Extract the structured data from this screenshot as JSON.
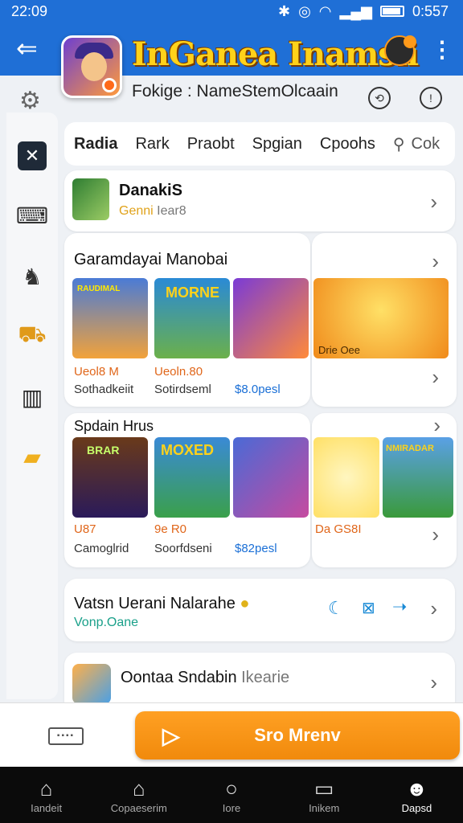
{
  "status_bar": {
    "time": "22:09",
    "clock": "0:557"
  },
  "header": {
    "title": "InGanea Inamsii",
    "subtitle": "Fokige : NameStemOlcaain",
    "back_icon": "arrow-left-icon",
    "menu_icon": "kebab-icon"
  },
  "tabs": [
    {
      "label": "Radia",
      "active": true
    },
    {
      "label": "Rark"
    },
    {
      "label": "Praobt"
    },
    {
      "label": "Spgian"
    },
    {
      "label": "Cpoohs"
    }
  ],
  "tab_search_label": "Cok",
  "rail_items": [
    "settings-icon",
    "close-box-icon",
    "controller-icon",
    "dino-icon",
    "cart-icon",
    "panel-icon",
    "folder-icon"
  ],
  "danakis": {
    "title": "DanakiS",
    "sub": "Genni",
    "sub2": "Iear8"
  },
  "section1": {
    "title": "Garamdayai Manobai",
    "tiles": [
      {
        "art": "RAUDIMAL",
        "value": "Ueol8 M",
        "name": "Sothadkeiit"
      },
      {
        "art": "MORNE",
        "value": "Ueoln.80",
        "name": "Sotirdseml"
      },
      {
        "art": "",
        "value": "",
        "name": "$8.0pesl"
      },
      {
        "art": "",
        "value": "",
        "name": "Drie Oee"
      }
    ]
  },
  "section2": {
    "title": "Spdain Hrus",
    "tiles": [
      {
        "art": "BRAR",
        "value": "U87",
        "name": "Camoglrid"
      },
      {
        "art": "MOXED",
        "value": "9e R0",
        "name": "Soorfdseni"
      },
      {
        "art": "",
        "value": "",
        "name": "$82pesl"
      },
      {
        "art": "",
        "value": "",
        "name": "Da GS8I"
      },
      {
        "art": "NMIRADAR",
        "value": "",
        "name": ""
      }
    ]
  },
  "vatsn": {
    "title": "Vatsn Uerani Nalarahe",
    "sub": "Vonp.Oane"
  },
  "contact": {
    "title": "Oontaa Sndabin",
    "suffix": "Ikearie"
  },
  "cta": {
    "label": "Sro Mrenv"
  },
  "bottom_nav": [
    {
      "label": "Iandeit",
      "icon": "home-icon",
      "active": false
    },
    {
      "label": "Copaeserim",
      "icon": "store-icon"
    },
    {
      "label": "Iore",
      "icon": "circle-icon"
    },
    {
      "label": "Inikem",
      "icon": "message-icon"
    },
    {
      "label": "Dapsd",
      "icon": "person-icon",
      "active": true
    }
  ]
}
